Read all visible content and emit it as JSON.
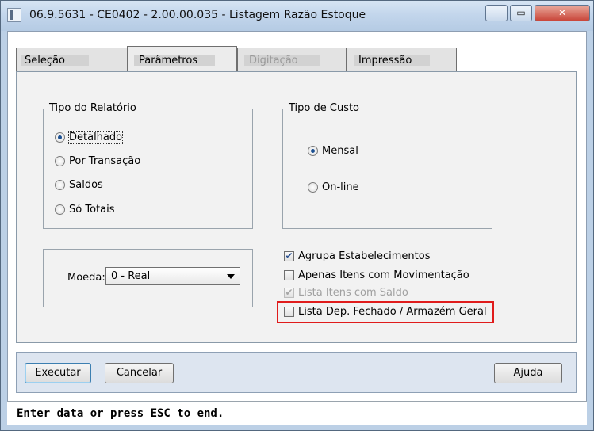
{
  "window": {
    "title": "06.9.5631 - CE0402 - 2.00.00.035 - Listagem Razão Estoque",
    "controls": {
      "minimize": "—",
      "maximize": "▭",
      "close": "✕"
    }
  },
  "tabs": [
    {
      "label": "Seleção",
      "state": "normal"
    },
    {
      "label": "Parâmetros",
      "state": "active"
    },
    {
      "label": "Digitação",
      "state": "disabled"
    },
    {
      "label": "Impressão",
      "state": "normal"
    }
  ],
  "tipo_relatorio": {
    "title": "Tipo do Relatório",
    "options": [
      {
        "label": "Detalhado",
        "selected": true
      },
      {
        "label": "Por Transação",
        "selected": false
      },
      {
        "label": "Saldos",
        "selected": false
      },
      {
        "label": "Só Totais",
        "selected": false
      }
    ]
  },
  "tipo_custo": {
    "title": "Tipo de Custo",
    "options": [
      {
        "label": "Mensal",
        "selected": true
      },
      {
        "label": "On-line",
        "selected": false
      }
    ]
  },
  "moeda": {
    "label": "Moeda:",
    "value": "0 - Real"
  },
  "checkboxes": [
    {
      "label": "Agrupa Estabelecimentos",
      "checked": true,
      "enabled": true
    },
    {
      "label": "Apenas Itens com Movimentação",
      "checked": false,
      "enabled": true
    },
    {
      "label": "Lista Itens com Saldo",
      "checked": true,
      "enabled": false
    },
    {
      "label": "Lista Dep. Fechado / Armazém Geral",
      "checked": false,
      "enabled": true
    }
  ],
  "buttons": {
    "execute": "Executar",
    "cancel": "Cancelar",
    "help": "Ajuda"
  },
  "status": "Enter data or press ESC to end.",
  "colors": {
    "highlight": "#e01c1c",
    "accent": "#1b4f91"
  }
}
